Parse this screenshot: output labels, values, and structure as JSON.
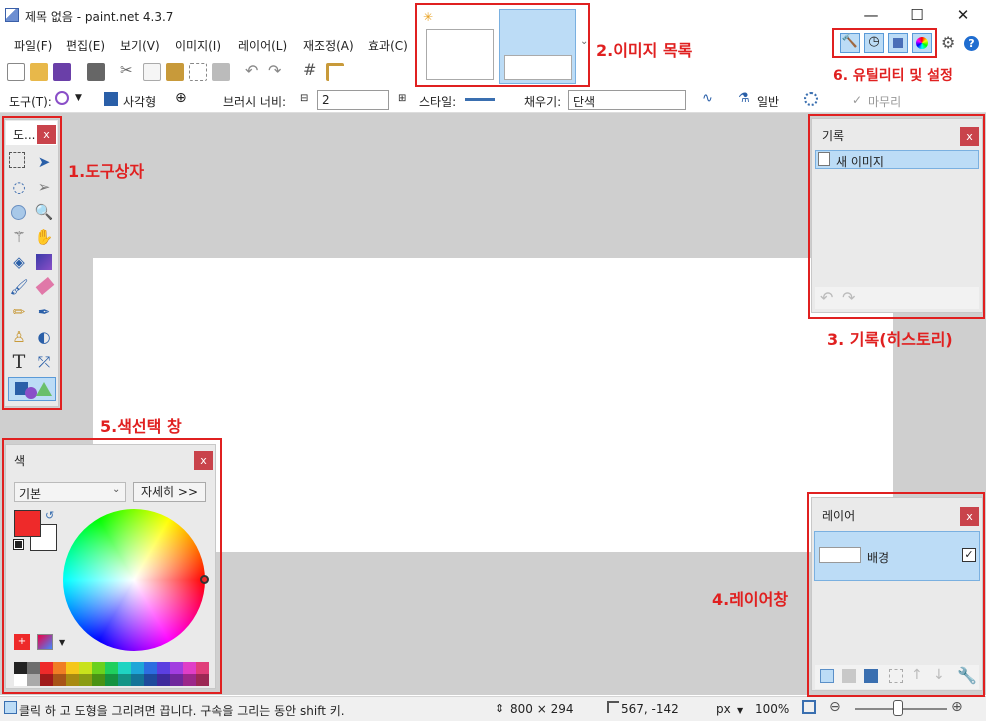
{
  "window": {
    "title": "제목 없음 - paint.net 4.3.7",
    "minimize": "—",
    "maximize": "☐",
    "close": "✕"
  },
  "menu": [
    "파일(F)",
    "편집(E)",
    "보기(V)",
    "이미지(I)",
    "레이어(L)",
    "재조정(A)",
    "효과(C)"
  ],
  "toolbar2": {
    "tool_label": "도구(T):",
    "shape_label": "사각형",
    "brush_width_label": "브러시 너비:",
    "brush_width_value": "2",
    "style_label": "스타일:",
    "fill_label": "채우기:",
    "fill_value": "단색",
    "blend_value": "일반",
    "finish_label": "마무리"
  },
  "tools_panel": {
    "title": "도...",
    "close": "x"
  },
  "history_panel": {
    "title": "기록",
    "close": "x",
    "items": [
      "새 이미지"
    ]
  },
  "layers_panel": {
    "title": "레이어",
    "close": "x",
    "layers": [
      {
        "name": "배경",
        "visible": true
      }
    ]
  },
  "colors_panel": {
    "title": "색",
    "close": "x",
    "mode": "기본",
    "more_button": "자세히 >>",
    "primary": "#ee2a2a",
    "secondary": "#ffffff"
  },
  "annotations": {
    "tools": "1.도구상자",
    "image_list": "2.이미지 목록",
    "history": "3. 기록(히스토리)",
    "layers": "4.레이어창",
    "colors": "5.색선택 창",
    "utilities": "6. 유틸리티 및 설정"
  },
  "status": {
    "hint": "클릭 하 고 도형을 그리려면 끕니다. 구속을 그리는 동안 shift 키.",
    "size": "800 × 294",
    "position": "567, -142",
    "unit": "px",
    "zoom": "100%"
  },
  "palette": [
    "#222222",
    "#6d6d6d",
    "#ee2a2a",
    "#f07d24",
    "#f5c71a",
    "#c9e21c",
    "#6ad11e",
    "#1fcf5e",
    "#1fd4c2",
    "#1ea6d8",
    "#2d6de0",
    "#5b3fe0",
    "#a23ee0",
    "#e03ec7",
    "#e03e7a",
    "#ffffff",
    "#aaaaaa",
    "#a01a1a",
    "#a85418",
    "#a88a12",
    "#8a9c14",
    "#4a9214",
    "#159240",
    "#149486",
    "#147498",
    "#1e4a9c",
    "#3e2a9c",
    "#70289c",
    "#9c288a",
    "#9c2854"
  ]
}
